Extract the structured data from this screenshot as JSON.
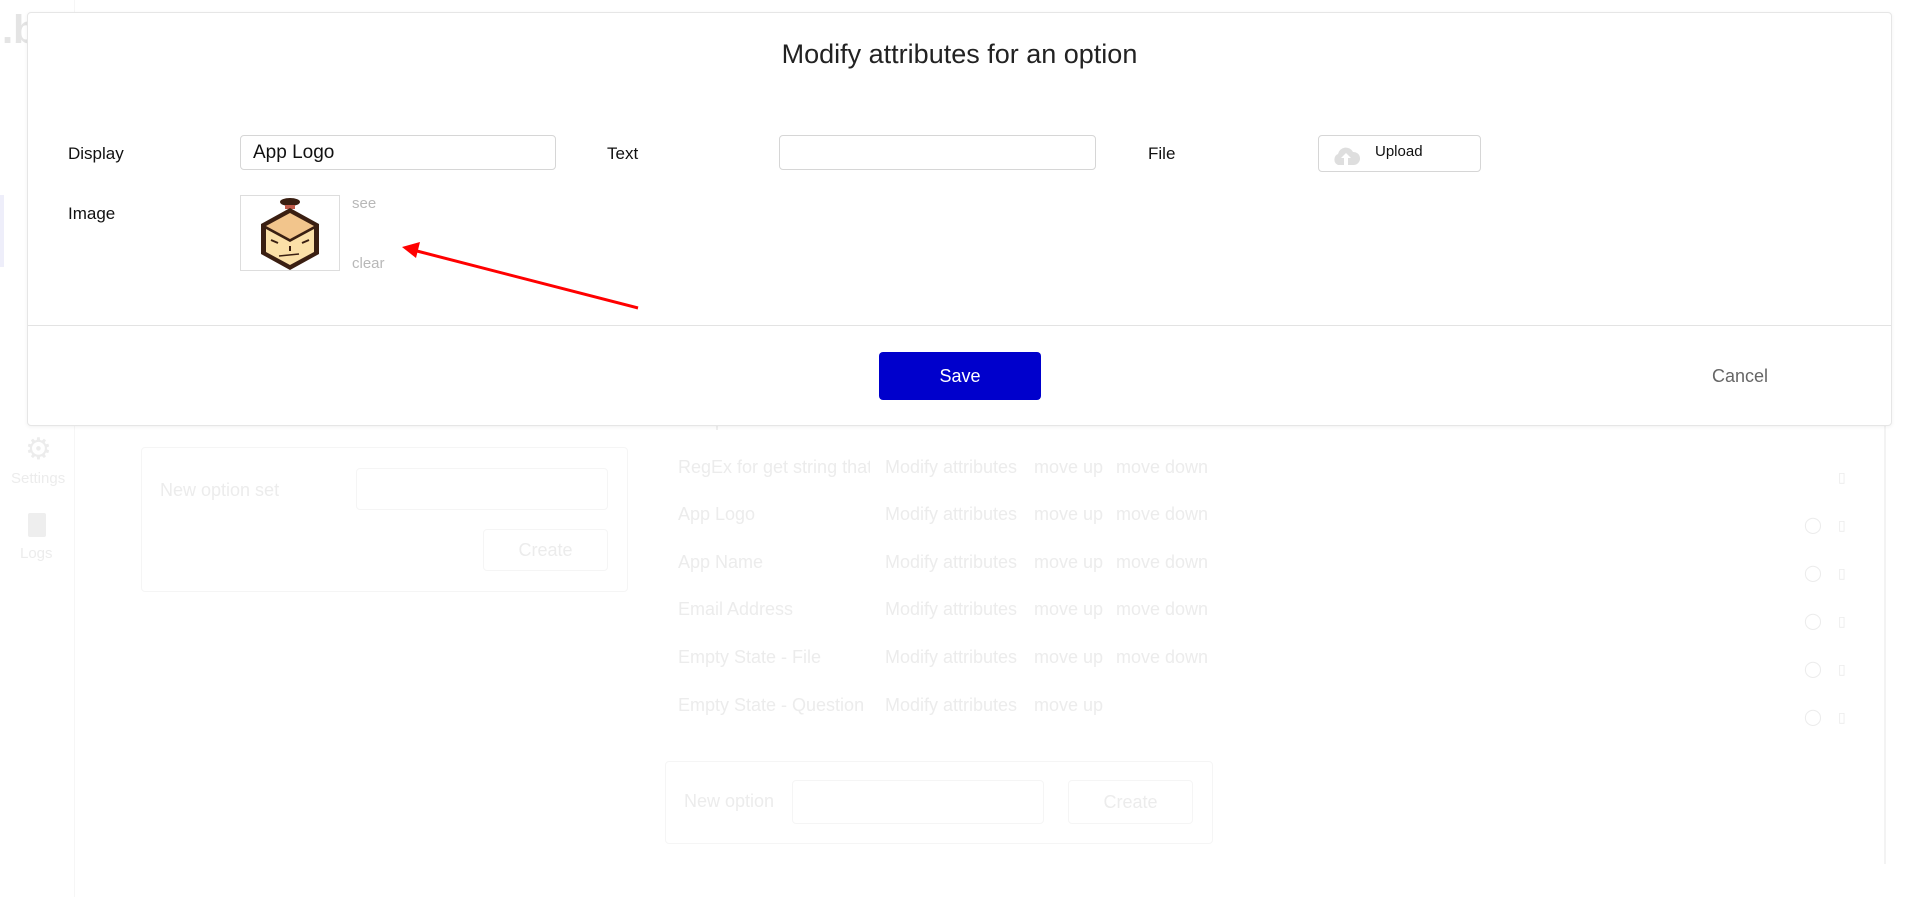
{
  "background": {
    "logo_letter": ".b",
    "sidebar": [
      {
        "label": "Settings",
        "icon": "gear-icon"
      },
      {
        "label": "Logs",
        "icon": "document-icon"
      }
    ],
    "new_option_set": {
      "label": "New option set",
      "create": "Create"
    },
    "options": [
      {
        "name": "Sample Code CSV",
        "actions": [
          "Modify attributes",
          "move up",
          "move down"
        ]
      },
      {
        "name": "RegEx for get string that",
        "actions": [
          "Modify attributes",
          "move up",
          "move down"
        ]
      },
      {
        "name": "App Logo",
        "actions": [
          "Modify attributes",
          "move up",
          "move down"
        ]
      },
      {
        "name": "App Name",
        "actions": [
          "Modify attributes",
          "move up",
          "move down"
        ]
      },
      {
        "name": "Email Address",
        "actions": [
          "Modify attributes",
          "move up",
          "move down"
        ]
      },
      {
        "name": "Empty State - File",
        "actions": [
          "Modify attributes",
          "move up",
          "move down"
        ]
      },
      {
        "name": "Empty State - Question",
        "actions": [
          "Modify attributes",
          "move up"
        ]
      }
    ],
    "new_option": {
      "label": "New option",
      "create": "Create"
    }
  },
  "modal": {
    "title": "Modify attributes for an option",
    "display_label": "Display",
    "display_value": "App Logo",
    "text_label": "Text",
    "text_value": "",
    "file_label": "File",
    "upload_label": "Upload",
    "image_label": "Image",
    "see_link": "see",
    "clear_link": "clear",
    "save_label": "Save",
    "cancel_label": "Cancel"
  },
  "colors": {
    "save_button": "#0000cc",
    "annotation_arrow": "#ff0000"
  }
}
